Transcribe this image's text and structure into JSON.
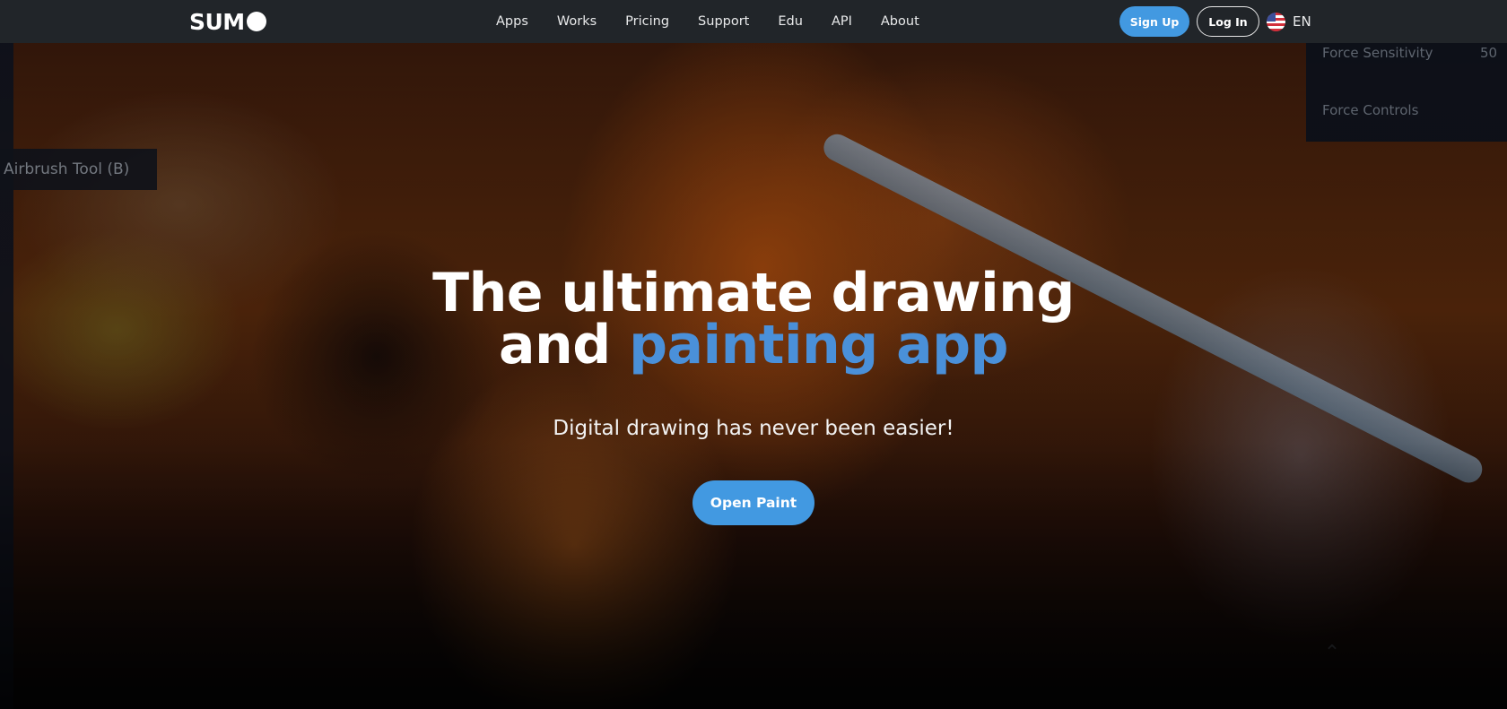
{
  "navbar": {
    "logo": "SUM",
    "links": [
      {
        "label": "Apps"
      },
      {
        "label": "Works"
      },
      {
        "label": "Pricing"
      },
      {
        "label": "Support"
      },
      {
        "label": "Edu"
      },
      {
        "label": "API"
      },
      {
        "label": "About"
      }
    ],
    "signup_label": "Sign Up",
    "login_label": "Log In",
    "language": {
      "icon": "us-flag-icon",
      "label": "EN"
    }
  },
  "hero": {
    "background_ui": {
      "tooltip": "Airbrush Tool (B)",
      "panel_rows": [
        {
          "label": "Force Sensitivity",
          "value": "50"
        },
        {
          "label": "Force Controls"
        }
      ]
    },
    "headline_line1": "The ultimate drawing",
    "headline_line2_plain": "and ",
    "headline_line2_accent": "painting app",
    "subtitle": "Digital drawing has never been easier!",
    "cta_label": "Open Paint"
  },
  "colors": {
    "navbar_bg": "#212529",
    "accent_blue": "#4299e1",
    "headline_accent": "#4a90d9",
    "text_white": "#ffffff"
  }
}
